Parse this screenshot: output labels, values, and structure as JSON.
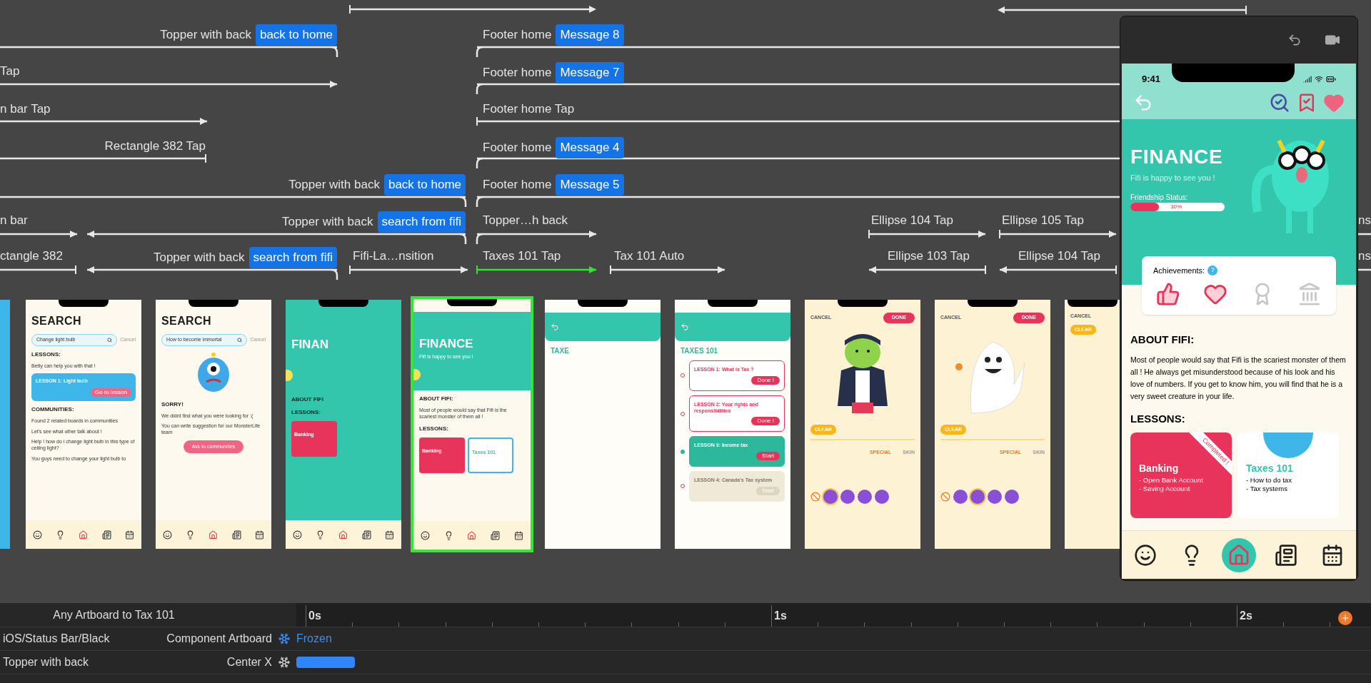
{
  "canvas": {
    "connectors": [
      {
        "label": "Topper with back",
        "tag": "back to home",
        "active": false
      },
      {
        "label": "Footer home",
        "tag": "Message 8",
        "active": false
      },
      {
        "label": "Tap",
        "active": false
      },
      {
        "label": "Footer home",
        "tag": "Message 7",
        "active": false
      },
      {
        "label": "n bar Tap",
        "active": false
      },
      {
        "label": "Footer home Tap",
        "active": false
      },
      {
        "label": "Rectangle 382 Tap",
        "active": false
      },
      {
        "label": "Footer home",
        "tag": "Message 4",
        "active": false
      },
      {
        "label": "Topper with back",
        "tag": "back to home",
        "active": false
      },
      {
        "label": "Footer home",
        "tag": "Message 5",
        "active": false
      },
      {
        "label": "n bar",
        "active": false
      },
      {
        "label": "Topper with back",
        "tag": "search from fifi",
        "active": false
      },
      {
        "label": "Topper…h back",
        "active": false
      },
      {
        "label": "Ellipse 104 Tap",
        "active": false
      },
      {
        "label": "Ellipse 105 Tap",
        "active": false
      },
      {
        "label": "ctangle 382",
        "active": false
      },
      {
        "label": "Topper with back",
        "tag": "search from fifi",
        "active": false
      },
      {
        "label": "Fifi-La…nsition",
        "active": false
      },
      {
        "label": "Taxes 101 Tap",
        "active": true
      },
      {
        "label": "Tax 101 Auto",
        "active": false
      },
      {
        "label": "Ellipse 103 Tap",
        "active": false
      },
      {
        "label": "Ellipse 104 Tap",
        "active": false
      },
      {
        "label": "ns"
      },
      {
        "label": "ns"
      }
    ],
    "artboards": [
      {
        "kind": "blue",
        "selected": false
      },
      {
        "kind": "cream",
        "selected": false,
        "nav": true,
        "items": [
          {
            "kind": "title",
            "text": "SEARCH"
          },
          {
            "kind": "field",
            "text": "Change light bulb",
            "action": "Cancel"
          },
          {
            "kind": "heading",
            "text": "LESSONS:"
          },
          {
            "kind": "text",
            "text": "Betty can help you with that !"
          },
          {
            "kind": "card",
            "text": "LESSON 1: Light bulb",
            "button": "Go to lesson"
          },
          {
            "kind": "heading",
            "text": "COMMUNITIES:"
          },
          {
            "kind": "text",
            "text": "Found 2 related boards in communities"
          },
          {
            "kind": "text",
            "text": "Let's see what other talk about !"
          },
          {
            "kind": "text",
            "text": "Help ! how do i change light bulb in this type of ceiling light?"
          },
          {
            "kind": "text",
            "text": "You guys need to change your light bulb to"
          }
        ]
      },
      {
        "kind": "cream",
        "selected": false,
        "nav": true,
        "items": [
          {
            "kind": "title",
            "text": "SEARCH"
          },
          {
            "kind": "field",
            "text": "How to become immortal",
            "action": "Cancel"
          },
          {
            "kind": "monster"
          },
          {
            "kind": "heading",
            "text": "SORRY!"
          },
          {
            "kind": "text",
            "text": "We didnt find what you were looking for :("
          },
          {
            "kind": "text",
            "text": "You can write suggestion for our MonsterLife team"
          },
          {
            "kind": "button",
            "text": "Ask to communities"
          }
        ]
      },
      {
        "kind": "teal",
        "selected": false,
        "nav": true,
        "items": [
          {
            "kind": "hero",
            "text": "FINAN"
          },
          {
            "kind": "heading",
            "text": "ABOUT FIFI"
          },
          {
            "kind": "heading",
            "text": "LESSONS:"
          },
          {
            "kind": "cards",
            "cards": [
              {
                "title": "Banking",
                "completed": true
              }
            ]
          }
        ]
      },
      {
        "kind": "cream",
        "selected": true,
        "nav": true,
        "items": [
          {
            "kind": "hero",
            "text": "FINANCE",
            "subtitle": "Fifi is happy to see you !"
          },
          {
            "kind": "heading",
            "text": "ABOUT FIFI:"
          },
          {
            "kind": "text",
            "text": "Most of people would say that Fifi is the scariest monster of them all !"
          },
          {
            "kind": "heading",
            "text": "LESSONS:"
          },
          {
            "kind": "cards",
            "cards": [
              {
                "title": "Banking",
                "completed": true
              },
              {
                "title": "Taxes 101",
                "completed": false
              }
            ]
          }
        ]
      },
      {
        "kind": "white",
        "selected": false,
        "items": [
          {
            "kind": "topbar"
          },
          {
            "kind": "heading",
            "text": "TAXE"
          }
        ]
      },
      {
        "kind": "white",
        "selected": false,
        "items": [
          {
            "kind": "topbar"
          },
          {
            "kind": "heading",
            "text": "TAXES 101"
          },
          {
            "kind": "lesson",
            "text": "LESSON 1: What is Tax ?",
            "button": "Done !",
            "done": true
          },
          {
            "kind": "lesson",
            "text": "LESSON 2: Your rights and responsibilities",
            "button": "Done !",
            "done": true
          },
          {
            "kind": "lesson",
            "text": "LESSON 3: Income tax",
            "button": "Start",
            "done": false,
            "locked": false
          },
          {
            "kind": "lesson",
            "text": "LESSON 4: Canada's Tax system",
            "button": "Start",
            "done": false,
            "locked": true
          }
        ]
      },
      {
        "kind": "costume",
        "selected": false,
        "items": [
          {
            "kind": "actions",
            "cancel": "CANCEL",
            "done": "DONE"
          },
          {
            "kind": "vampire"
          },
          {
            "kind": "clear",
            "text": "CLEAR"
          },
          {
            "kind": "tabs",
            "tabs": [
              {
                "label": "SPECIAL",
                "selected": true
              },
              {
                "label": "SKIN",
                "selected": false
              }
            ]
          },
          {
            "kind": "swatches",
            "swatches": [
              {
                "selected": false
              },
              {
                "selected": true
              },
              {
                "selected": false
              },
              {
                "selected": false
              },
              {
                "selected": false
              }
            ]
          }
        ]
      },
      {
        "kind": "costume",
        "selected": false,
        "items": [
          {
            "kind": "actions",
            "cancel": "CANCEL",
            "done": "DONE"
          },
          {
            "kind": "ghost"
          },
          {
            "kind": "clear",
            "text": "CLEAR"
          },
          {
            "kind": "tabs",
            "tabs": [
              {
                "label": "SPECIAL",
                "selected": true
              },
              {
                "label": "SKIN",
                "selected": false
              }
            ]
          },
          {
            "kind": "swatches",
            "swatches": [
              {
                "selected": false
              },
              {
                "selected": false
              },
              {
                "selected": true
              },
              {
                "selected": false
              },
              {
                "selected": false
              }
            ]
          }
        ]
      },
      {
        "kind": "costume",
        "selected": false,
        "items": [
          {
            "kind": "actions",
            "cancel": "CANCEL"
          },
          {
            "kind": "clear",
            "text": "CLEAR"
          }
        ]
      }
    ]
  },
  "preview": {
    "time": "9:41",
    "title": "FINANCE",
    "subtitle": "Fifi is happy to see you !",
    "status_label": "Friendship Status:",
    "friendship": {
      "level": 0.3,
      "reading": "30%"
    },
    "achievements": {
      "label": "Achievements:",
      "help": "?",
      "badges": [
        {
          "unlocked": true
        },
        {
          "unlocked": true
        },
        {
          "unlocked": false
        },
        {
          "unlocked": false
        }
      ]
    },
    "about": {
      "heading": "ABOUT FIFI:",
      "text": "Most of people would say that Fifi is the scariest monster of them all ! He always get misunderstood because of his look and his love of numbers. If you get to know him, you will find that he is a very sweet creature in your life."
    },
    "lessons": {
      "heading": "LESSONS:",
      "cards": [
        {
          "title": "Banking",
          "completed": true,
          "ribbon": "Completed !",
          "items": [
            "- Open Bank Account",
            "- Saving Account"
          ]
        },
        {
          "title": "Taxes 101",
          "completed": false,
          "items": [
            "- How to do tax",
            "- Tax systems"
          ]
        }
      ]
    },
    "nav": [
      {
        "selected": false
      },
      {
        "selected": false
      },
      {
        "selected": true
      },
      {
        "selected": false
      },
      {
        "selected": false
      }
    ]
  },
  "timeline": {
    "header": "Any Artboard to Tax 101",
    "ticks": [
      "0s",
      "1s",
      "2s"
    ],
    "rows": [
      {
        "kind": "frozen",
        "layer": "iOS/Status Bar/Black",
        "property": "Component Artboard",
        "value": "Frozen"
      },
      {
        "kind": "keyframe",
        "layer": "Topper with back",
        "property": "Center X"
      }
    ]
  }
}
